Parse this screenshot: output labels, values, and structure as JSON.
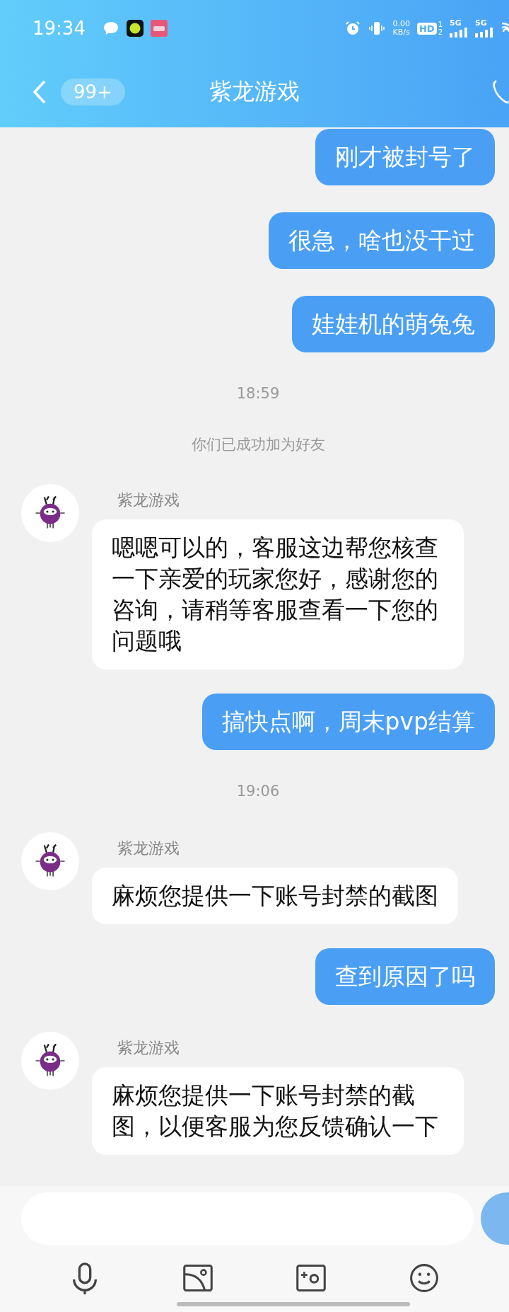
{
  "status_bar": {
    "time": "19:34",
    "network_speed": "0.00",
    "speed_unit": "KB/s",
    "hd_label": "HD",
    "sim_slots": [
      "1",
      "2"
    ],
    "signals": [
      {
        "label": "5G"
      },
      {
        "label": "5G"
      }
    ]
  },
  "header": {
    "unread_badge": "99+",
    "title": "紫龙游戏"
  },
  "messages": [
    {
      "kind": "outgoing",
      "text": "刚才被封号了"
    },
    {
      "kind": "outgoing",
      "text": "很急，啥也没干过"
    },
    {
      "kind": "outgoing",
      "text": "娃娃机的萌兔兔"
    },
    {
      "kind": "time",
      "text": "18:59"
    },
    {
      "kind": "system",
      "text": "你们已成功加为好友"
    },
    {
      "kind": "incoming",
      "sender": "紫龙游戏",
      "text": "嗯嗯可以的，客服这边帮您核查一下亲爱的玩家您好，感谢您的咨询，请稍等客服查看一下您的问题哦"
    },
    {
      "kind": "outgoing",
      "text": "搞快点啊，周末pvp结算"
    },
    {
      "kind": "time",
      "text": "19:06"
    },
    {
      "kind": "incoming",
      "sender": "紫龙游戏",
      "text": "麻烦您提供一下账号封禁的截图"
    },
    {
      "kind": "outgoing",
      "text": "查到原因了吗"
    },
    {
      "kind": "incoming",
      "sender": "紫龙游戏",
      "text": "麻烦您提供一下账号封禁的截图，以便客服为您反馈确认一下"
    }
  ]
}
